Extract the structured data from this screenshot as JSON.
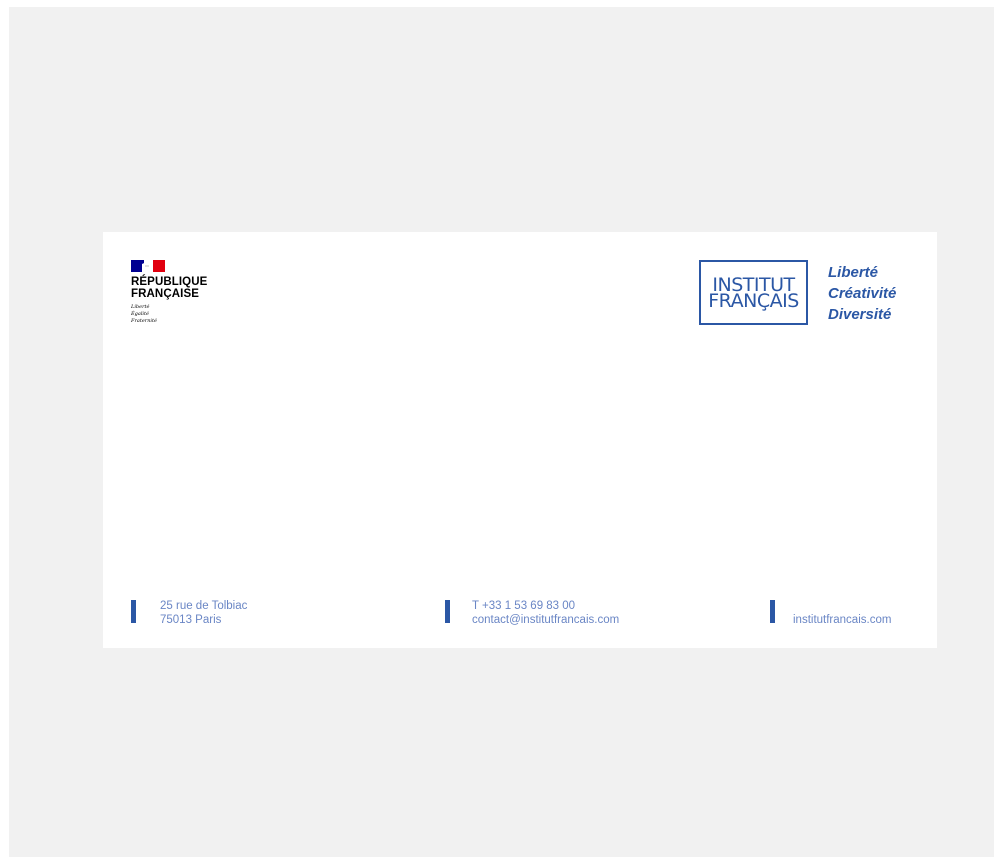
{
  "logo_rf": {
    "line1": "RÉPUBLIQUE",
    "line2": "FRANÇAISE",
    "motto": [
      "Liberté",
      "Égalité",
      "Fraternité"
    ],
    "flag_colors": [
      "#000091",
      "#ffffff",
      "#e1000f"
    ]
  },
  "logo_if": {
    "line1": "INSTITUT",
    "line2": "FRANÇAIS",
    "color": "#2b57a5"
  },
  "tagline": [
    "Liberté",
    "Créativité",
    "Diversité"
  ],
  "footer": {
    "address": [
      "25 rue de Tolbiac",
      "75013 Paris"
    ],
    "contact": [
      "T +33 1 53 69 83 00",
      "contact@institutfrancais.com"
    ],
    "website": "institutfrancais.com"
  }
}
